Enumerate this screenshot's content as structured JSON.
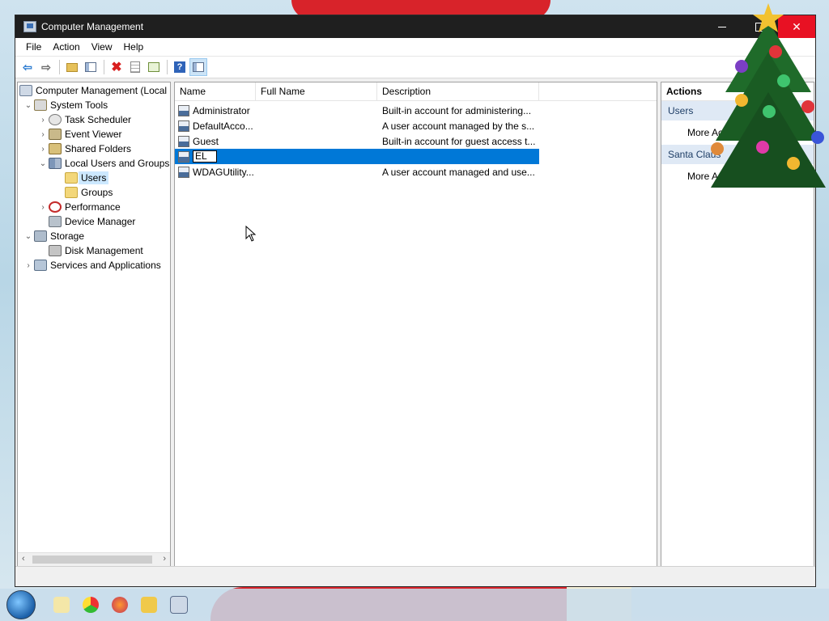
{
  "window": {
    "title": "Computer Management",
    "min_label": "",
    "close_label": "✕"
  },
  "menu": [
    "File",
    "Action",
    "View",
    "Help"
  ],
  "toolbar": {
    "help_label": "?"
  },
  "tree": {
    "items": [
      {
        "label": "Computer Management (Local",
        "indent": 0,
        "expander": "",
        "icon": "computer-icon",
        "selected": false
      },
      {
        "label": "System Tools",
        "indent": 1,
        "expander": "v",
        "icon": "tools-icon",
        "selected": false
      },
      {
        "label": "Task Scheduler",
        "indent": 2,
        "expander": ">",
        "icon": "clock-icon",
        "selected": false
      },
      {
        "label": "Event Viewer",
        "indent": 2,
        "expander": ">",
        "icon": "event-viewer-icon",
        "selected": false
      },
      {
        "label": "Shared Folders",
        "indent": 2,
        "expander": ">",
        "icon": "shared-folder-icon",
        "selected": false
      },
      {
        "label": "Local Users and Groups",
        "indent": 2,
        "expander": "v",
        "icon": "users-groups-icon",
        "selected": false
      },
      {
        "label": "Users",
        "indent": 3,
        "expander": "",
        "icon": "folder-icon",
        "selected": true
      },
      {
        "label": "Groups",
        "indent": 3,
        "expander": "",
        "icon": "folder-icon",
        "selected": false
      },
      {
        "label": "Performance",
        "indent": 2,
        "expander": ">",
        "icon": "performance-icon",
        "selected": false
      },
      {
        "label": "Device Manager",
        "indent": 2,
        "expander": "",
        "icon": "device-manager-icon",
        "selected": false
      },
      {
        "label": "Storage",
        "indent": 1,
        "expander": "v",
        "icon": "storage-icon",
        "selected": false
      },
      {
        "label": "Disk Management",
        "indent": 2,
        "expander": "",
        "icon": "disk-icon",
        "selected": false
      },
      {
        "label": "Services and Applications",
        "indent": 1,
        "expander": ">",
        "icon": "services-icon",
        "selected": false
      }
    ]
  },
  "list": {
    "columns": [
      "Name",
      "Full Name",
      "Description"
    ],
    "rows": [
      {
        "name": "Administrator",
        "full_name": "",
        "description": "Built-in account for administering..."
      },
      {
        "name": "DefaultAcco...",
        "full_name": "",
        "description": "A user account managed by the s..."
      },
      {
        "name": "Guest",
        "full_name": "",
        "description": "Built-in account for guest access t..."
      },
      {
        "name": "EL",
        "full_name": "",
        "description": "",
        "editing": true
      },
      {
        "name": "WDAGUtility...",
        "full_name": "",
        "description": "A user account managed and use..."
      }
    ]
  },
  "actions": {
    "title": "Actions",
    "sections": [
      {
        "label": "Users",
        "items": [
          "More Actions"
        ]
      },
      {
        "label": "Santa Claus",
        "items": [
          "More Actions"
        ]
      }
    ]
  },
  "colors": {
    "selection": "#0078d7",
    "titlebar": "#1f1f1f",
    "close_button": "#e81123"
  }
}
